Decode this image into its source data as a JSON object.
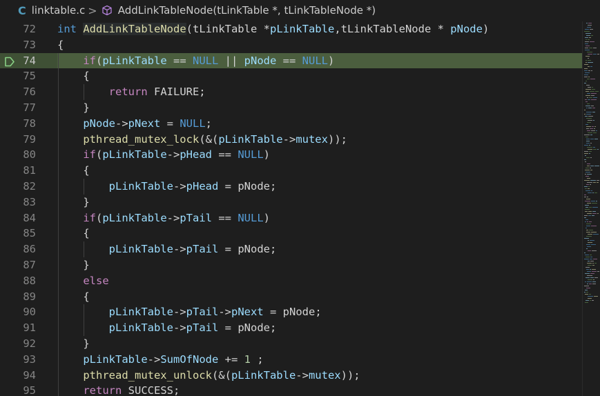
{
  "breadcrumb": {
    "file_icon": "C",
    "file_name": "linktable.c",
    "separator": ">",
    "symbol_icon": "cube-icon",
    "symbol_name": "AddLinkTableNode(tLinkTable *, tLinkTableNode *)"
  },
  "colors": {
    "background": "#1e1e1e",
    "current_line": "#3f5035",
    "keyword": "#569cd6",
    "control": "#c586c0",
    "function": "#dcdcaa",
    "variable": "#9cdcfe",
    "macro": "#4fc1ff",
    "number": "#b5cea8",
    "text": "#d4d4d4",
    "line_number": "#858585",
    "breakpoint": "#89d185"
  },
  "editor": {
    "current_line": 74,
    "breakpoint_line": 74,
    "lines": [
      {
        "n": "72",
        "tokens": [
          [
            "kw",
            "int"
          ],
          [
            "plain",
            " "
          ],
          [
            "fn-decl",
            "AddLinkTableNode"
          ],
          [
            "plain",
            "(tLinkTable *"
          ],
          [
            "var",
            "pLinkTable"
          ],
          [
            "plain",
            ",tLinkTableNode * "
          ],
          [
            "var",
            "pNode"
          ],
          [
            "plain",
            ")"
          ]
        ]
      },
      {
        "n": "73",
        "tokens": [
          [
            "plain",
            "{"
          ]
        ]
      },
      {
        "n": "74",
        "tokens": [
          [
            "plain",
            "    "
          ],
          [
            "ctl",
            "if"
          ],
          [
            "plain",
            "("
          ],
          [
            "var",
            "pLinkTable"
          ],
          [
            "plain",
            " == "
          ],
          [
            "kw",
            "NULL"
          ],
          [
            "plain",
            " || "
          ],
          [
            "var",
            "pNode"
          ],
          [
            "plain",
            " == "
          ],
          [
            "kw",
            "NULL"
          ],
          [
            "plain",
            ")"
          ]
        ]
      },
      {
        "n": "75",
        "tokens": [
          [
            "plain",
            "    {"
          ]
        ]
      },
      {
        "n": "76",
        "tokens": [
          [
            "plain",
            "        "
          ],
          [
            "ctl",
            "return"
          ],
          [
            "plain",
            " FAILURE;"
          ]
        ]
      },
      {
        "n": "77",
        "tokens": [
          [
            "plain",
            "    }"
          ]
        ]
      },
      {
        "n": "78",
        "tokens": [
          [
            "plain",
            "    "
          ],
          [
            "var",
            "pNode"
          ],
          [
            "plain",
            "->"
          ],
          [
            "var",
            "pNext"
          ],
          [
            "plain",
            " = "
          ],
          [
            "kw",
            "NULL"
          ],
          [
            "plain",
            ";"
          ]
        ]
      },
      {
        "n": "79",
        "tokens": [
          [
            "plain",
            "    "
          ],
          [
            "fn",
            "pthread_mutex_lock"
          ],
          [
            "plain",
            "(&("
          ],
          [
            "var",
            "pLinkTable"
          ],
          [
            "plain",
            "->"
          ],
          [
            "var",
            "mutex"
          ],
          [
            "plain",
            "));"
          ]
        ]
      },
      {
        "n": "80",
        "tokens": [
          [
            "plain",
            "    "
          ],
          [
            "ctl",
            "if"
          ],
          [
            "plain",
            "("
          ],
          [
            "var",
            "pLinkTable"
          ],
          [
            "plain",
            "->"
          ],
          [
            "var",
            "pHead"
          ],
          [
            "plain",
            " == "
          ],
          [
            "kw",
            "NULL"
          ],
          [
            "plain",
            ")"
          ]
        ]
      },
      {
        "n": "81",
        "tokens": [
          [
            "plain",
            "    {"
          ]
        ]
      },
      {
        "n": "82",
        "tokens": [
          [
            "plain",
            "        "
          ],
          [
            "var",
            "pLinkTable"
          ],
          [
            "plain",
            "->"
          ],
          [
            "var",
            "pHead"
          ],
          [
            "plain",
            " = pNode;"
          ]
        ]
      },
      {
        "n": "83",
        "tokens": [
          [
            "plain",
            "    }"
          ]
        ]
      },
      {
        "n": "84",
        "tokens": [
          [
            "plain",
            "    "
          ],
          [
            "ctl",
            "if"
          ],
          [
            "plain",
            "("
          ],
          [
            "var",
            "pLinkTable"
          ],
          [
            "plain",
            "->"
          ],
          [
            "var",
            "pTail"
          ],
          [
            "plain",
            " == "
          ],
          [
            "kw",
            "NULL"
          ],
          [
            "plain",
            ")"
          ]
        ]
      },
      {
        "n": "85",
        "tokens": [
          [
            "plain",
            "    {"
          ]
        ]
      },
      {
        "n": "86",
        "tokens": [
          [
            "plain",
            "        "
          ],
          [
            "var",
            "pLinkTable"
          ],
          [
            "plain",
            "->"
          ],
          [
            "var",
            "pTail"
          ],
          [
            "plain",
            " = pNode;"
          ]
        ]
      },
      {
        "n": "87",
        "tokens": [
          [
            "plain",
            "    }"
          ]
        ]
      },
      {
        "n": "88",
        "tokens": [
          [
            "plain",
            "    "
          ],
          [
            "ctl",
            "else"
          ]
        ]
      },
      {
        "n": "89",
        "tokens": [
          [
            "plain",
            "    {"
          ]
        ]
      },
      {
        "n": "90",
        "tokens": [
          [
            "plain",
            "        "
          ],
          [
            "var",
            "pLinkTable"
          ],
          [
            "plain",
            "->"
          ],
          [
            "var",
            "pTail"
          ],
          [
            "plain",
            "->"
          ],
          [
            "var",
            "pNext"
          ],
          [
            "plain",
            " = pNode;"
          ]
        ]
      },
      {
        "n": "91",
        "tokens": [
          [
            "plain",
            "        "
          ],
          [
            "var",
            "pLinkTable"
          ],
          [
            "plain",
            "->"
          ],
          [
            "var",
            "pTail"
          ],
          [
            "plain",
            " = pNode;"
          ]
        ]
      },
      {
        "n": "92",
        "tokens": [
          [
            "plain",
            "    }"
          ]
        ]
      },
      {
        "n": "93",
        "tokens": [
          [
            "plain",
            "    "
          ],
          [
            "var",
            "pLinkTable"
          ],
          [
            "plain",
            "->"
          ],
          [
            "var",
            "SumOfNode"
          ],
          [
            "plain",
            " += "
          ],
          [
            "num",
            "1"
          ],
          [
            "plain",
            " ;"
          ]
        ]
      },
      {
        "n": "94",
        "tokens": [
          [
            "plain",
            "    "
          ],
          [
            "fn",
            "pthread_mutex_unlock"
          ],
          [
            "plain",
            "(&("
          ],
          [
            "var",
            "pLinkTable"
          ],
          [
            "plain",
            "->"
          ],
          [
            "var",
            "mutex"
          ],
          [
            "plain",
            "));"
          ]
        ]
      },
      {
        "n": "95",
        "tokens": [
          [
            "plain",
            "    "
          ],
          [
            "ctl",
            "return"
          ],
          [
            "plain",
            " SUCCESS;"
          ]
        ]
      }
    ]
  }
}
